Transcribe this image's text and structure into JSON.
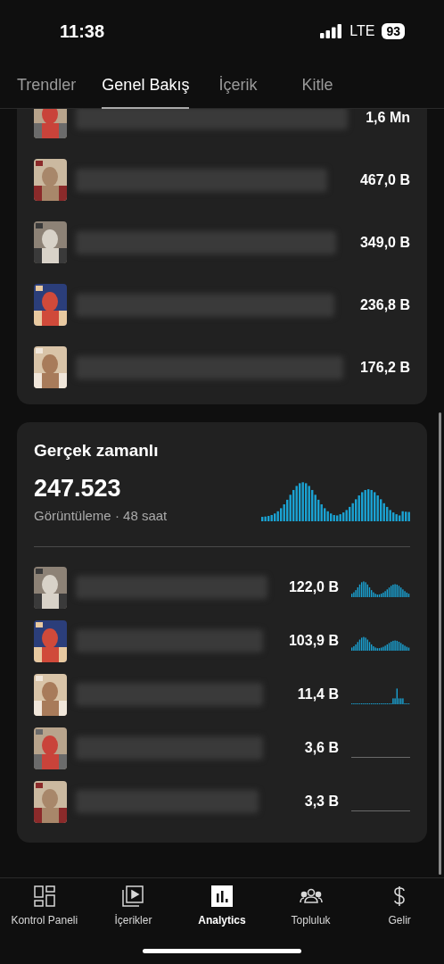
{
  "status_bar": {
    "time": "11:38",
    "network": "LTE",
    "battery": "93"
  },
  "tabs": [
    {
      "label": "Trendler",
      "selected": false
    },
    {
      "label": "Genel Bakış",
      "selected": true
    },
    {
      "label": "İçerik",
      "selected": false
    },
    {
      "label": "Kitle",
      "selected": false
    }
  ],
  "top_content": {
    "rows": [
      {
        "value": "1,6 Mn"
      },
      {
        "value": "467,0 B"
      },
      {
        "value": "349,0 B"
      },
      {
        "value": "236,8 B"
      },
      {
        "value": "176,2 B"
      }
    ]
  },
  "realtime": {
    "title": "Gerçek zamanlı",
    "total": "247.523",
    "subtitle": "Görüntüleme · 48 saat",
    "rows": [
      {
        "value": "122,0 B"
      },
      {
        "value": "103,9 B"
      },
      {
        "value": "11,4 B"
      },
      {
        "value": "3,6 B"
      },
      {
        "value": "3,3 B"
      }
    ]
  },
  "bottom_nav": [
    {
      "label": "Kontrol Paneli",
      "selected": false
    },
    {
      "label": "İçerikler",
      "selected": false
    },
    {
      "label": "Analytics",
      "selected": true
    },
    {
      "label": "Topluluk",
      "selected": false
    },
    {
      "label": "Gelir",
      "selected": false
    }
  ]
}
